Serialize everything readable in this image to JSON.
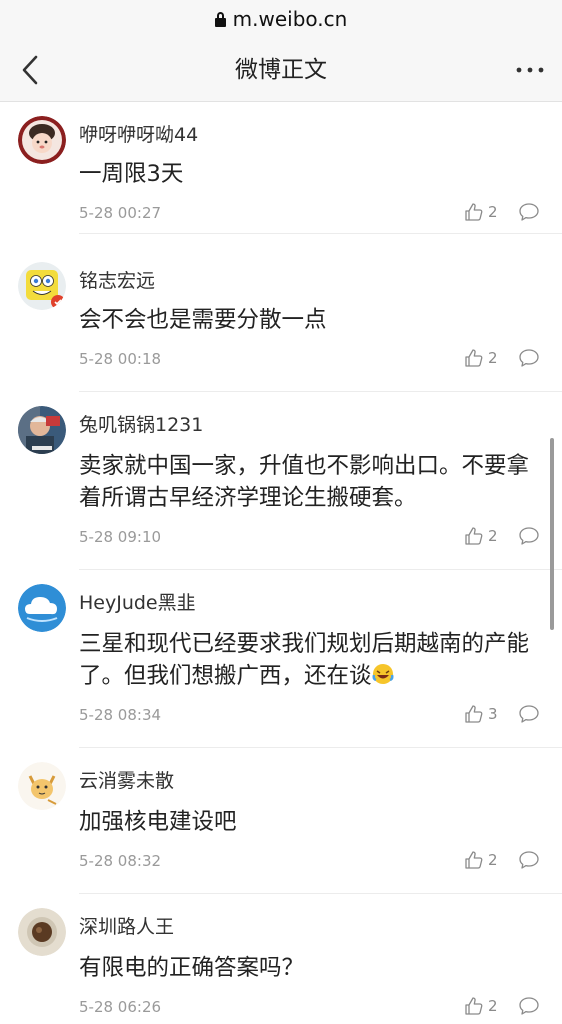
{
  "browser": {
    "url": "m.weibo.cn"
  },
  "header": {
    "title": "微博正文"
  },
  "comments": [
    {
      "username": "咿呀咿呀呦44",
      "text": "一周限3天",
      "time": "5-28 00:27",
      "likes": "2",
      "avatar": "girl-avatar"
    },
    {
      "username": "铭志宏远",
      "text": "会不会也是需要分散一点",
      "time": "5-28 00:18",
      "likes": "2",
      "avatar": "spongebob-avatar"
    },
    {
      "username": "兔叽锅锅1231",
      "text": "卖家就中国一家，升值也不影响出口。不要拿着所谓古早经济学理论生搬硬套。",
      "time": "5-28 09:10",
      "likes": "2",
      "avatar": "man-avatar"
    },
    {
      "username": "HeyJude黑韭",
      "text": "三星和现代已经要求我们规划后期越南的产能了。但我们想搬广西，还在谈",
      "time": "5-28 08:34",
      "likes": "3",
      "avatar": "cloud-avatar"
    },
    {
      "username": "云消雾未散",
      "text": "加强核电建设吧",
      "time": "5-28 08:32",
      "likes": "2",
      "avatar": "cat-avatar"
    },
    {
      "username": "深圳路人王",
      "text": "有限电的正确答案吗？",
      "time": "5-28 06:26",
      "likes": "2",
      "avatar": "coffee-avatar"
    }
  ],
  "icons": {
    "like": "thumbs-up-icon",
    "reply": "comment-bubble-icon",
    "emoji": "laughing-crying-emoji"
  },
  "colors": {
    "bar": "#f7f7f7",
    "text": "#222222",
    "meta": "#9a9a9a"
  }
}
